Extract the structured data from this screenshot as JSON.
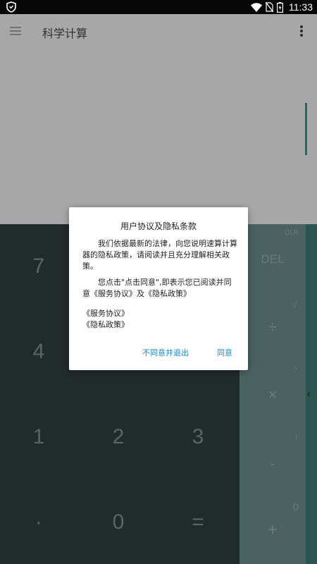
{
  "status_bar": {
    "time": "11:33",
    "icons": [
      "shield-icon",
      "wifi-icon",
      "no-sim-icon",
      "battery-charging-icon"
    ]
  },
  "app_bar": {
    "title": "科学计算",
    "menu_icon": "hamburger-menu-icon",
    "more_icon": "more-vertical-icon"
  },
  "numpad": {
    "keys": [
      "7",
      "4",
      "1",
      "2",
      "3",
      "·",
      "0",
      "="
    ]
  },
  "operators": {
    "clr": "CLR",
    "del": "DEL",
    "sqrt": "√",
    "divide": "÷",
    "power": "^",
    "multiply": "×",
    "factorial": "!",
    "minus": "-",
    "zero": "0",
    "plus": "+"
  },
  "advanced_panel": {
    "toggle_icon": "chevron-left-icon",
    "toggle_glyph": "‹"
  },
  "dialog": {
    "title": "用户协议及隐私条款",
    "paragraph1": "我们依据最新的法律，向您说明速算计算器的隐私政策，请阅读并且充分理解相关政策。",
    "paragraph2": "您点击\"点击同意\",即表示您已阅读并同意《服务协议》及《隐私政策》",
    "link_service": "《服务协议》",
    "link_privacy": "《隐私政策》",
    "decline_label": "不同意并退出",
    "accept_label": "同意"
  },
  "colors": {
    "status_bar": "#070707",
    "dimmed_surface": "#a7a7a7",
    "numpad_bg": "#222b2c",
    "ops_bg": "#4a6362",
    "advanced_bg": "#2a5550",
    "accent": "#1e88c8"
  }
}
